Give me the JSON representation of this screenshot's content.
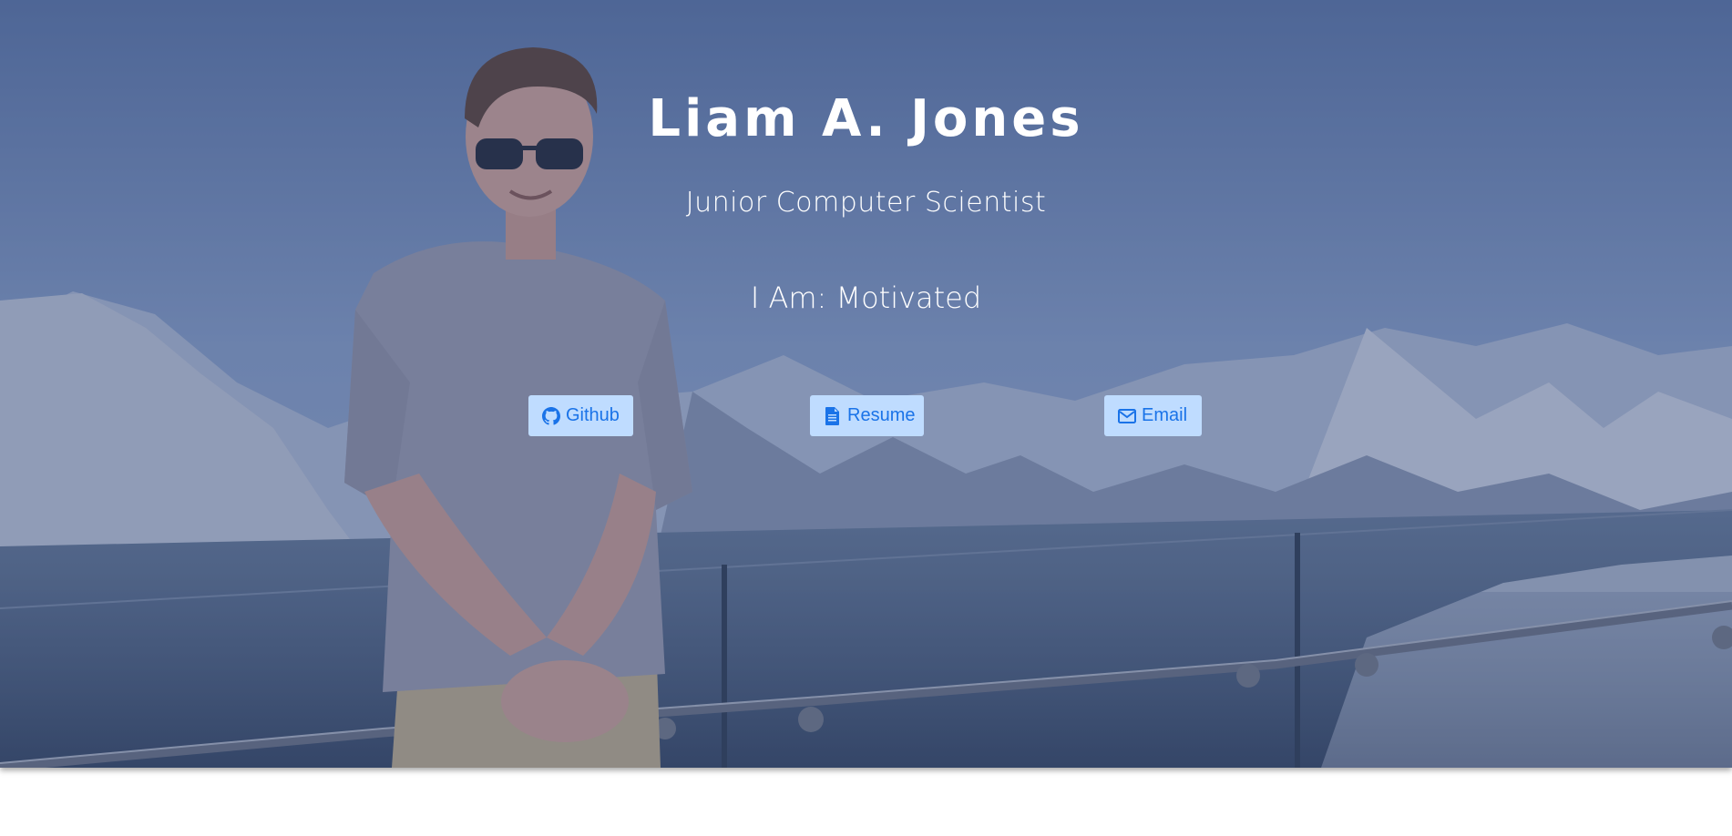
{
  "header": {
    "name": "Liam A. Jones",
    "subtitle": "Junior Computer Scientist",
    "iam_prefix": "I Am: ",
    "iam_word": "Motivated"
  },
  "buttons": {
    "github": {
      "label": "Github",
      "icon": "github-icon"
    },
    "resume": {
      "label": "Resume",
      "icon": "file-text-icon"
    },
    "email": {
      "label": "Email",
      "icon": "envelope-icon"
    }
  },
  "colors": {
    "overlay": "#344878",
    "button_bg": "#bfdcff",
    "button_text": "#1a73e8",
    "heading_text": "#ffffff"
  }
}
